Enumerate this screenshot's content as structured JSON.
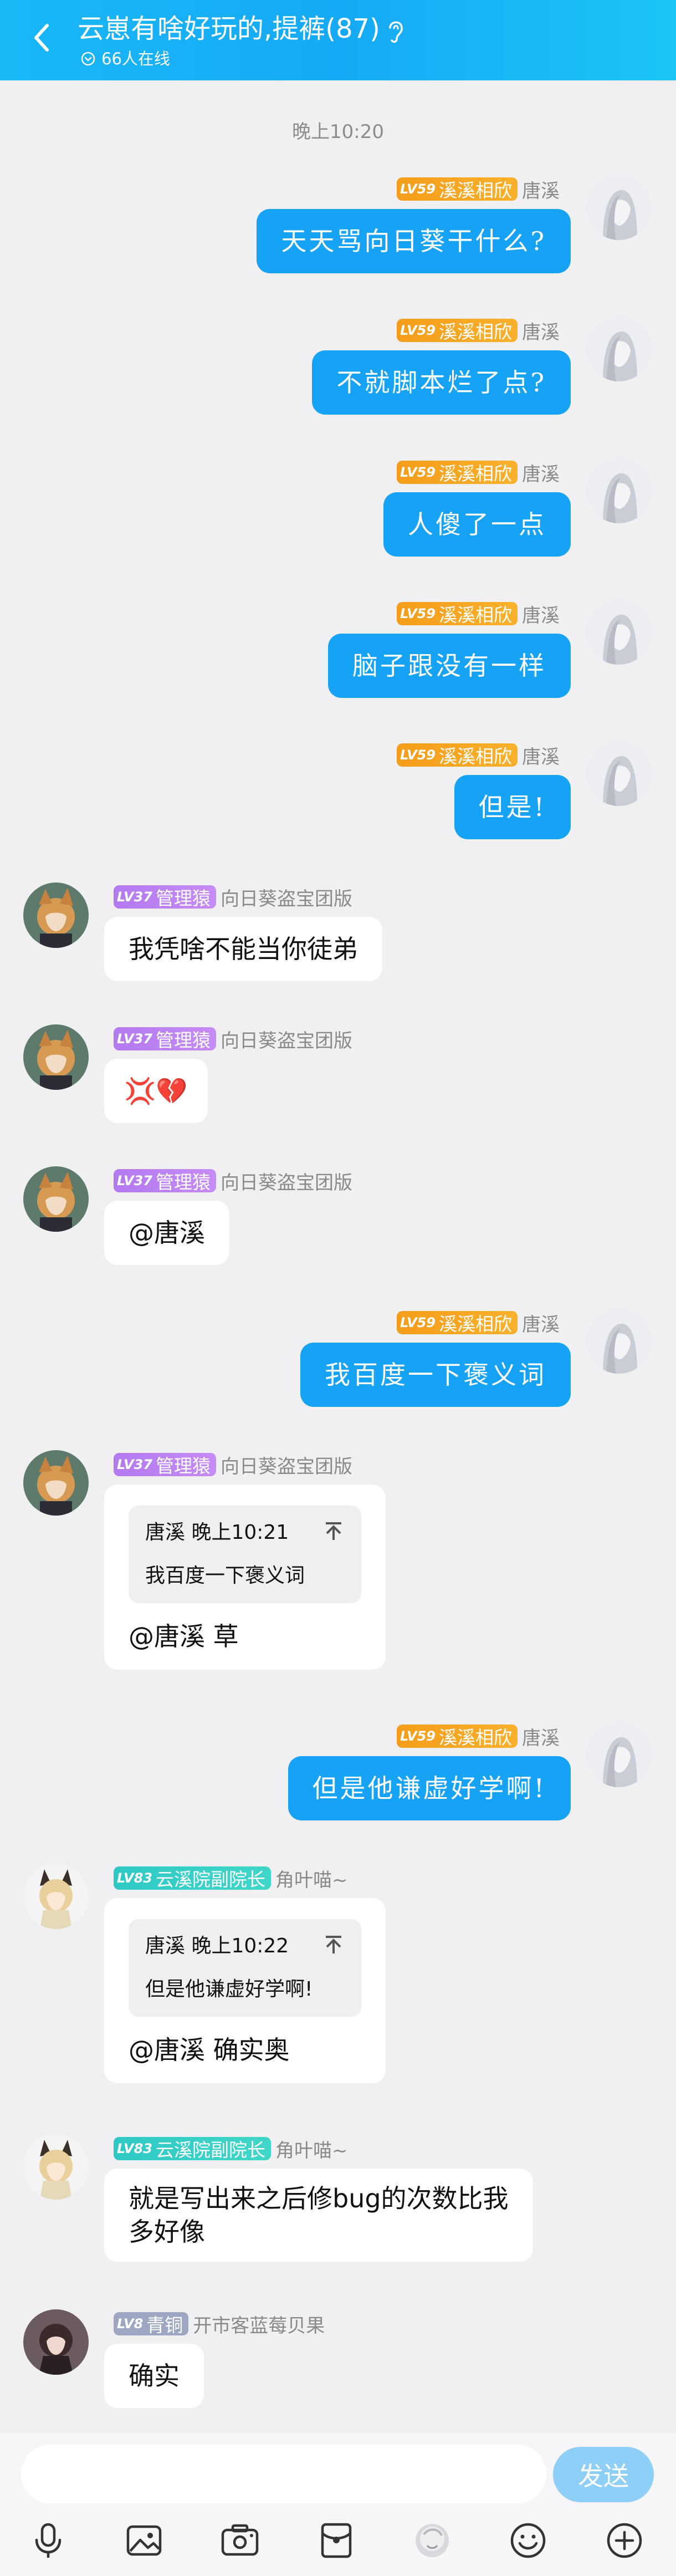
{
  "header": {
    "title": "云崽有啥好玩的,提裤(87)",
    "online": "66人在线"
  },
  "time_label": "晚上10:20",
  "messages": [
    {
      "side": "right",
      "level": "LV59",
      "badge": "溪溪相欣",
      "badge_color": "orange",
      "nick": "唐溪",
      "text": "天天骂向日葵干什么?"
    },
    {
      "side": "right",
      "level": "LV59",
      "badge": "溪溪相欣",
      "badge_color": "orange",
      "nick": "唐溪",
      "text": "不就脚本烂了点?"
    },
    {
      "side": "right",
      "level": "LV59",
      "badge": "溪溪相欣",
      "badge_color": "orange",
      "nick": "唐溪",
      "text": "人傻了一点"
    },
    {
      "side": "right",
      "level": "LV59",
      "badge": "溪溪相欣",
      "badge_color": "orange",
      "nick": "唐溪",
      "text": "脑子跟没有一样"
    },
    {
      "side": "right",
      "level": "LV59",
      "badge": "溪溪相欣",
      "badge_color": "orange",
      "nick": "唐溪",
      "text": "但是!"
    },
    {
      "side": "left",
      "level": "LV37",
      "badge": "管理猿",
      "badge_color": "purple",
      "nick": "向日葵盗宝团版",
      "text": "我凭啥不能当你徒弟"
    },
    {
      "side": "left",
      "level": "LV37",
      "badge": "管理猿",
      "badge_color": "purple",
      "nick": "向日葵盗宝团版",
      "text": "💢💔"
    },
    {
      "side": "left",
      "level": "LV37",
      "badge": "管理猿",
      "badge_color": "purple",
      "nick": "向日葵盗宝团版",
      "text": "@唐溪"
    },
    {
      "side": "right",
      "level": "LV59",
      "badge": "溪溪相欣",
      "badge_color": "orange",
      "nick": "唐溪",
      "text": "我百度一下褒义词"
    },
    {
      "side": "left",
      "level": "LV37",
      "badge": "管理猿",
      "badge_color": "purple",
      "nick": "向日葵盗宝团版",
      "quote_head": "唐溪 晚上10:21",
      "quote_text": "我百度一下褒义词",
      "text": "@唐溪 草"
    },
    {
      "side": "right",
      "level": "LV59",
      "badge": "溪溪相欣",
      "badge_color": "orange",
      "nick": "唐溪",
      "text": "但是他谦虚好学啊!"
    },
    {
      "side": "left",
      "level": "LV83",
      "badge": "云溪院副院长",
      "badge_color": "teal",
      "nick": "角叶喵~",
      "quote_head": "唐溪 晚上10:22",
      "quote_text": "但是他谦虚好学啊!",
      "text": "@唐溪 确实奥"
    },
    {
      "side": "left",
      "level": "LV83",
      "badge": "云溪院副院长",
      "badge_color": "teal",
      "nick": "角叶喵~",
      "text_line1": "就是写出来之后修bug的次数比我",
      "text_line2": "多好像"
    },
    {
      "side": "left",
      "level": "LV8",
      "badge": "青铜",
      "badge_color": "gray",
      "nick": "开市客蓝莓贝果",
      "text": "确实"
    }
  ],
  "input": {
    "placeholder": "",
    "send_label": "发送"
  },
  "toolbar": [
    "microphone-icon",
    "image-icon",
    "camera-icon",
    "red-packet-icon",
    "sticker-icon",
    "emoji-icon",
    "plus-icon"
  ]
}
